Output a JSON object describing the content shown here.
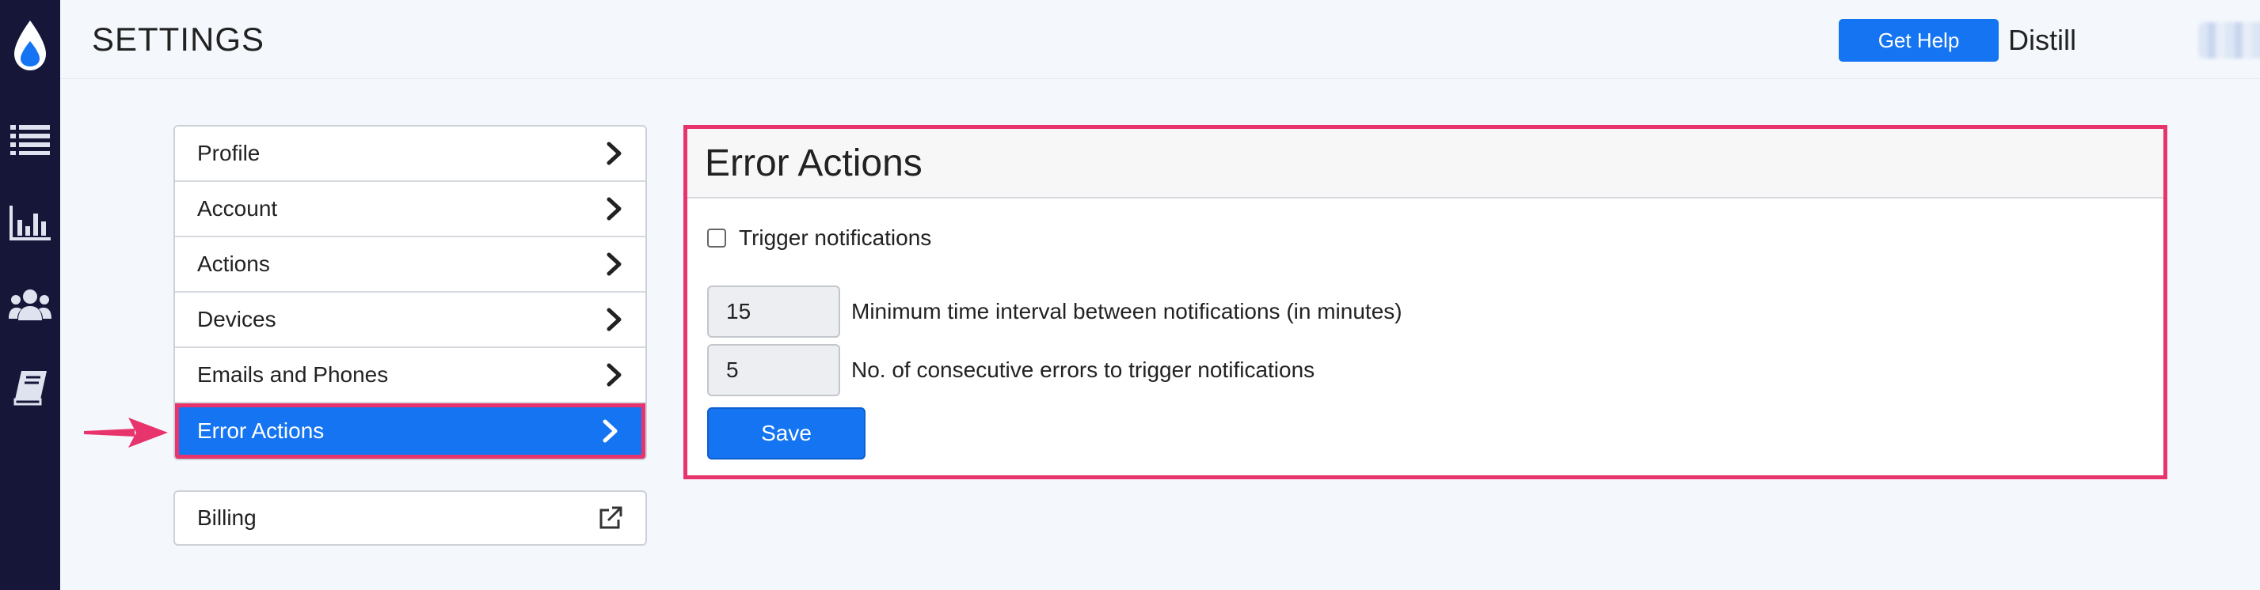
{
  "header": {
    "title": "SETTINGS",
    "help_label": "Get Help",
    "brand": "Distill"
  },
  "rail": {
    "items": [
      "droplet-logo-icon",
      "list-icon",
      "bar-chart-icon",
      "users-icon",
      "book-icon"
    ]
  },
  "menu": {
    "items": [
      {
        "label": "Profile"
      },
      {
        "label": "Account"
      },
      {
        "label": "Actions"
      },
      {
        "label": "Devices"
      },
      {
        "label": "Emails and Phones"
      },
      {
        "label": "Error Actions"
      }
    ],
    "active_index": 5,
    "billing_label": "Billing"
  },
  "panel": {
    "title": "Error Actions",
    "trigger_label": "Trigger notifications",
    "trigger_checked": false,
    "interval_value": "15",
    "interval_label": "Minimum time interval between notifications (in minutes)",
    "errors_value": "5",
    "errors_label": "No. of consecutive errors to trigger notifications",
    "save_label": "Save"
  },
  "colors": {
    "rail": "#151638",
    "accent": "#1474f2",
    "highlight": "#e8346c"
  }
}
